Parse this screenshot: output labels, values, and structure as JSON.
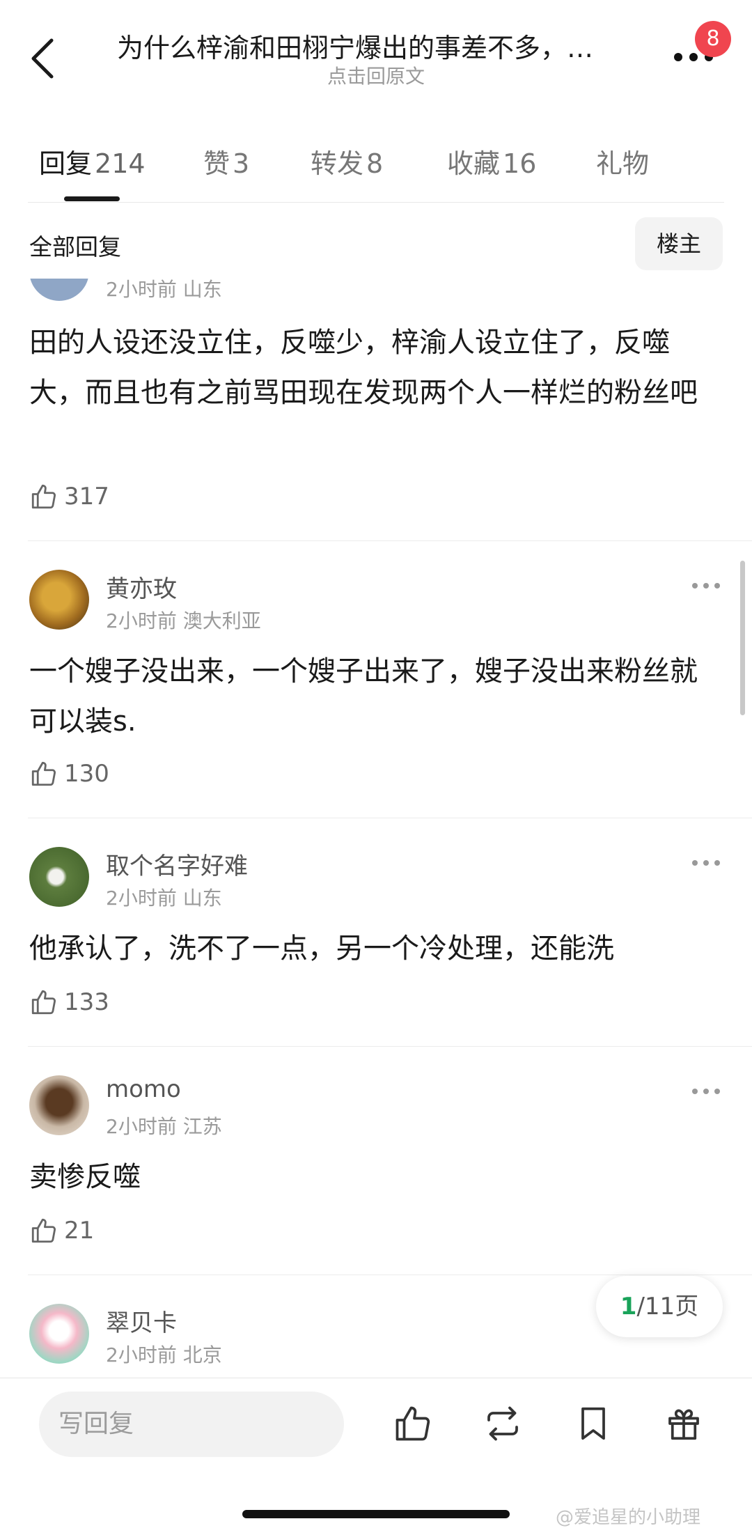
{
  "header": {
    "title": "为什么梓渝和田栩宁爆出的事差不多，…",
    "subtitle": "点击回原文",
    "notification_count": "8"
  },
  "tabs": [
    {
      "label": "回复",
      "count": "214"
    },
    {
      "label": "赞",
      "count": "3"
    },
    {
      "label": "转发",
      "count": "8"
    },
    {
      "label": "收藏",
      "count": "16"
    },
    {
      "label": "礼物",
      "count": ""
    }
  ],
  "filter": {
    "label": "全部回复",
    "op_button": "楼主"
  },
  "comments": [
    {
      "username": "",
      "meta": "2小时前 山东",
      "text": "田的人设还没立住，反噬少，梓渝人设立住了，反噬大，而且也有之前骂田现在发现两个人一样烂的粉丝吧",
      "likes": "317"
    },
    {
      "username": "黄亦玫",
      "meta": "2小时前 澳大利亚",
      "text": "一个嫂子没出来，一个嫂子出来了，嫂子没出来粉丝就可以装s.",
      "likes": "130"
    },
    {
      "username": "取个名字好难",
      "meta": "2小时前 山东",
      "text": "他承认了，洗不了一点，另一个冷处理，还能洗",
      "likes": "133"
    },
    {
      "username": "momo",
      "meta": "2小时前 江苏",
      "text": "卖惨反噬",
      "likes": "21"
    },
    {
      "username": "翠贝卡",
      "meta": "2小时前 北京",
      "text": "",
      "likes": ""
    }
  ],
  "pager": {
    "current": "1",
    "total": "/11页"
  },
  "bottom_bar": {
    "reply_placeholder": "写回复"
  },
  "watermark": "@爱追星的小助理",
  "icons": [
    "back-icon",
    "more-icon",
    "like-icon",
    "repost-icon",
    "bookmark-icon",
    "gift-icon"
  ]
}
